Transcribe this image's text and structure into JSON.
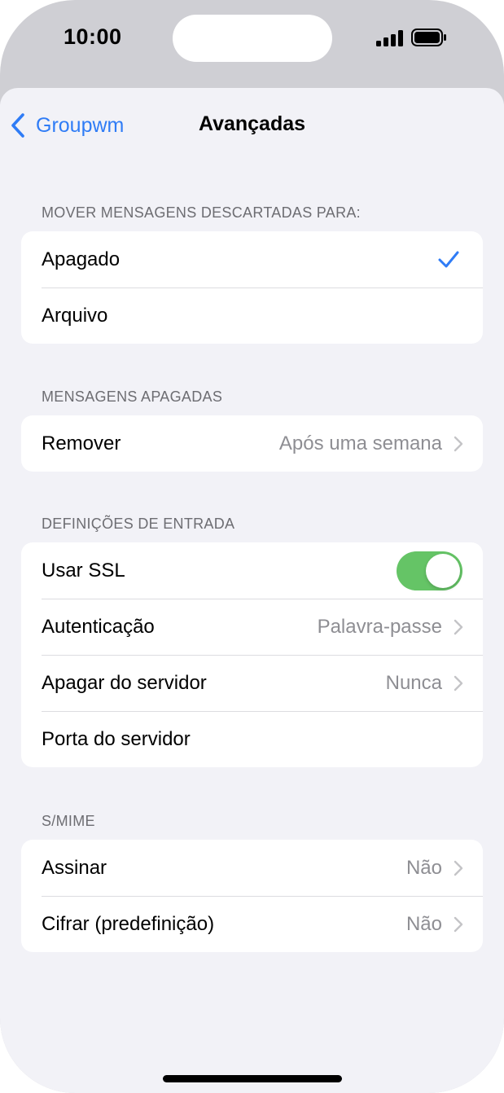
{
  "status": {
    "time": "10:00"
  },
  "nav": {
    "back_label": "Groupwm",
    "title": "Avançadas"
  },
  "sections": {
    "deleted_move": {
      "header": "MOVER MENSAGENS DESCARTADAS PARA:",
      "items": [
        {
          "label": "Apagado",
          "selected": true
        },
        {
          "label": "Arquivo",
          "selected": false
        }
      ]
    },
    "deleted_messages": {
      "header": "MENSAGENS APAGADAS",
      "items": [
        {
          "label": "Remover",
          "value": "Após uma semana"
        }
      ]
    },
    "incoming": {
      "header": "DEFINIÇÕES DE ENTRADA",
      "items": [
        {
          "label": "Usar SSL",
          "toggle": true
        },
        {
          "label": "Autenticação",
          "value": "Palavra-passe"
        },
        {
          "label": "Apagar do servidor",
          "value": "Nunca"
        },
        {
          "label": "Porta do servidor"
        }
      ]
    },
    "smime": {
      "header": "S/MIME",
      "items": [
        {
          "label": "Assinar",
          "value": "Não"
        },
        {
          "label": "Cifrar (predefinição)",
          "value": "Não"
        }
      ]
    }
  },
  "colors": {
    "accent": "#2f7cf6",
    "toggle_on": "#65c466",
    "secondary_text": "#8e8e93",
    "background": "#f2f2f7"
  }
}
